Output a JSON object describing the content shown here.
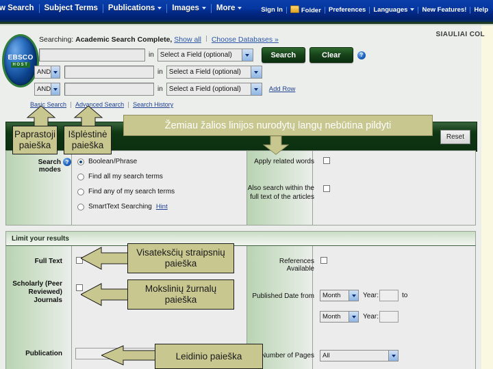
{
  "topnav": {
    "left_items": [
      {
        "label": "w Search",
        "caret": false
      },
      {
        "label": "Subject Terms",
        "caret": false
      },
      {
        "label": "Publications",
        "caret": true
      },
      {
        "label": "Images",
        "caret": true
      },
      {
        "label": "More",
        "caret": true
      }
    ],
    "right_items": [
      {
        "label": "Sign In",
        "icon": "",
        "caret": false
      },
      {
        "label": "Folder",
        "icon": "folder-icon",
        "caret": false
      },
      {
        "label": "Preferences",
        "icon": "",
        "caret": false
      },
      {
        "label": "Languages",
        "icon": "",
        "caret": true
      },
      {
        "label": "New Features!",
        "icon": "",
        "caret": false
      },
      {
        "label": "Help",
        "icon": "",
        "caret": false
      }
    ]
  },
  "logo": {
    "line1": "EBSCO",
    "line2": "HOST"
  },
  "institution": "SIAULIAI COL",
  "searching": {
    "label": "Searching:",
    "database": "Academic Search Complete,",
    "show_all": "Show all",
    "choose_databases": "Choose Databases »"
  },
  "search_rows": [
    {
      "bool": "",
      "value": "",
      "field": "Select a Field (optional)"
    },
    {
      "bool": "AND",
      "value": "",
      "field": "Select a Field (optional)"
    },
    {
      "bool": "AND",
      "value": "",
      "field": "Select a Field (optional)"
    }
  ],
  "buttons": {
    "search": "Search",
    "clear": "Clear",
    "add_row": "Add Row",
    "reset": "Reset",
    "help_badge": "?"
  },
  "tabs": [
    {
      "label": "Basic Search"
    },
    {
      "label": "Advanced Search"
    },
    {
      "label": "Search History"
    }
  ],
  "search_modes": {
    "label": "Search modes",
    "options": [
      {
        "label": "Boolean/Phrase",
        "selected": true
      },
      {
        "label": "Find all my search terms",
        "selected": false
      },
      {
        "label": "Find any of my search terms",
        "selected": false
      },
      {
        "label": "SmartText Searching",
        "selected": false,
        "hint": "Hint"
      }
    ],
    "right_options": [
      {
        "label": "Apply related words",
        "checked": false
      },
      {
        "label": "Also search within the full text of the articles",
        "checked": false
      }
    ]
  },
  "limit": {
    "header": "Limit your results",
    "full_text": {
      "label": "Full Text",
      "checked": false
    },
    "scholarly": {
      "label": "Scholarly (Peer Reviewed) Journals",
      "checked": false
    },
    "publication": {
      "label": "Publication",
      "value": ""
    },
    "references_available": {
      "label": "References Available",
      "checked": false
    },
    "published_date": {
      "label": "Published Date from",
      "month_from": "Month",
      "year_label_from": "Year:",
      "year_from": "",
      "to": "to",
      "month_to": "Month",
      "year_label_to": "Year:",
      "year_to": ""
    },
    "number_of_pages": {
      "label": "Number of Pages",
      "value": "All"
    }
  },
  "annotations": {
    "banner": "Žemiau žalios linijos nurodytų langų nebūtina pildyti",
    "basic": "Paprastoji paieška",
    "advanced": "Išplėstinė paieška",
    "fulltext": "Visateksčių straipsnių paieška",
    "scholarly": "Mokslinių žurnalų paieška",
    "publication": "Leidinio paieška"
  },
  "colors": {
    "nav_blue": "#0536a0",
    "green_band": "#0e3612",
    "callout_tan": "#c9c790",
    "link_blue": "#1c3f94"
  }
}
